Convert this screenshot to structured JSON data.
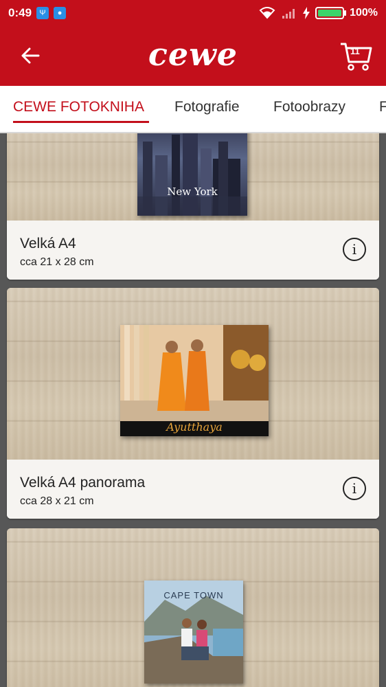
{
  "status_bar": {
    "time": "0:49",
    "battery_percent": "100%",
    "battery_level": 1.0
  },
  "app_bar": {
    "logo_text": "cewe",
    "cart_count": "11"
  },
  "tabs": [
    {
      "label": "CEWE FOTOKNIHA",
      "active": true
    },
    {
      "label": "Fotografie",
      "active": false
    },
    {
      "label": "Fotoobrazy",
      "active": false
    },
    {
      "label": "F",
      "active": false
    }
  ],
  "products": [
    {
      "title": "Velká A4",
      "size": "cca 21 x 28 cm",
      "cover_text": "New York",
      "icon": "info-icon"
    },
    {
      "title": "Velká A4 panorama",
      "size": "cca 28 x 21 cm",
      "cover_text": "Ayutthaya",
      "icon": "info-icon"
    },
    {
      "title": "",
      "size": "",
      "cover_text": "CAPE TOWN",
      "icon": "info-icon"
    }
  ],
  "colors": {
    "brand_red": "#c30f1b",
    "tab_active": "#c30f1b",
    "battery_green": "#3cd46a"
  }
}
